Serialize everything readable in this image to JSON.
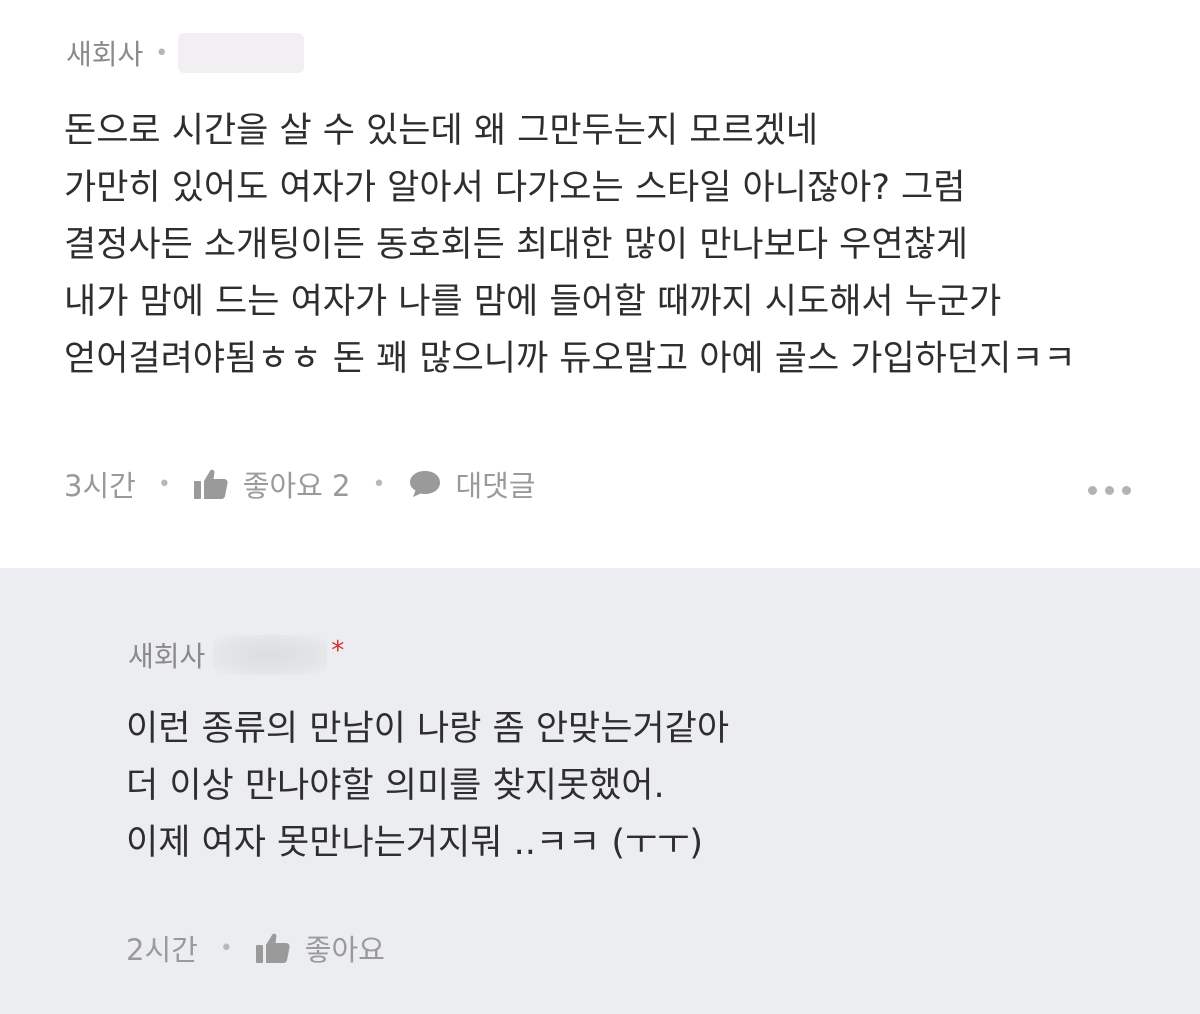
{
  "comment": {
    "author": "새회사",
    "text_lines": [
      "돈으로 시간을 살 수 있는데 왜 그만두는지 모르겠네",
      "가만히 있어도 여자가 알아서 다가오는 스타일 아니잖아? 그럼",
      "결정사든 소개팅이든 동호회든 최대한 많이 만나보다 우연찮게",
      "내가 맘에 드는 여자가 나를 맘에 들어할 때까지 시도해서 누군가",
      "얻어걸려야됨ㅎㅎ 돈 꽤 많으니까 듀오말고 아예 골스 가입하던지ㅋㅋ"
    ],
    "time": "3시간",
    "like_label": "좋아요 2",
    "reply_label": "대댓글"
  },
  "reply": {
    "author": "새회사",
    "star": "*",
    "text_lines": [
      "이런 종류의 만남이 나랑 좀 안맞는거같아",
      "더 이상 만나야할 의미를 찾지못했어.",
      "이제 여자 못만나는거지뭐 ..ㅋㅋ (ㅜㅜ)"
    ],
    "time": "2시간",
    "like_label": "좋아요"
  },
  "icons": {
    "like": "thumbs-up-icon",
    "reply": "speech-bubble-icon",
    "more": "more-dots-icon"
  },
  "colors": {
    "reply_background": "#ecedf0",
    "star": "#d32f2f",
    "meta": "#9a9a9a"
  }
}
